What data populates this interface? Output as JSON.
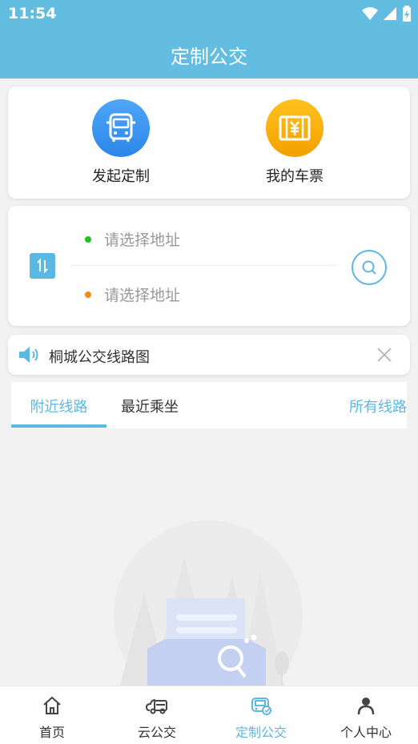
{
  "status_bar": {
    "time": "11:54"
  },
  "header": {
    "title": "定制公交"
  },
  "actions": {
    "launch_label": "发起定制",
    "tickets_label": "我的车票"
  },
  "route": {
    "start_placeholder": "请选择地址",
    "end_placeholder": "请选择地址"
  },
  "notice": {
    "text": "桐城公交线路图"
  },
  "tabs": {
    "nearby": "附近线路",
    "recent": "最近乘坐",
    "all_routes": "所有线路",
    "active": "nearby"
  },
  "bottom_nav": [
    {
      "label": "首页",
      "icon": "home-icon"
    },
    {
      "label": "云公交",
      "icon": "cloud-bus-icon"
    },
    {
      "label": "定制公交",
      "icon": "custom-bus-icon",
      "active": true
    },
    {
      "label": "个人中心",
      "icon": "person-icon"
    }
  ],
  "colors": {
    "primary": "#62bde0",
    "accent": "#5bb8e2",
    "launch_blue": "#3a96f0",
    "ticket_orange": "#f9b20e",
    "start_dot": "#20c020",
    "end_dot": "#f58a16"
  }
}
